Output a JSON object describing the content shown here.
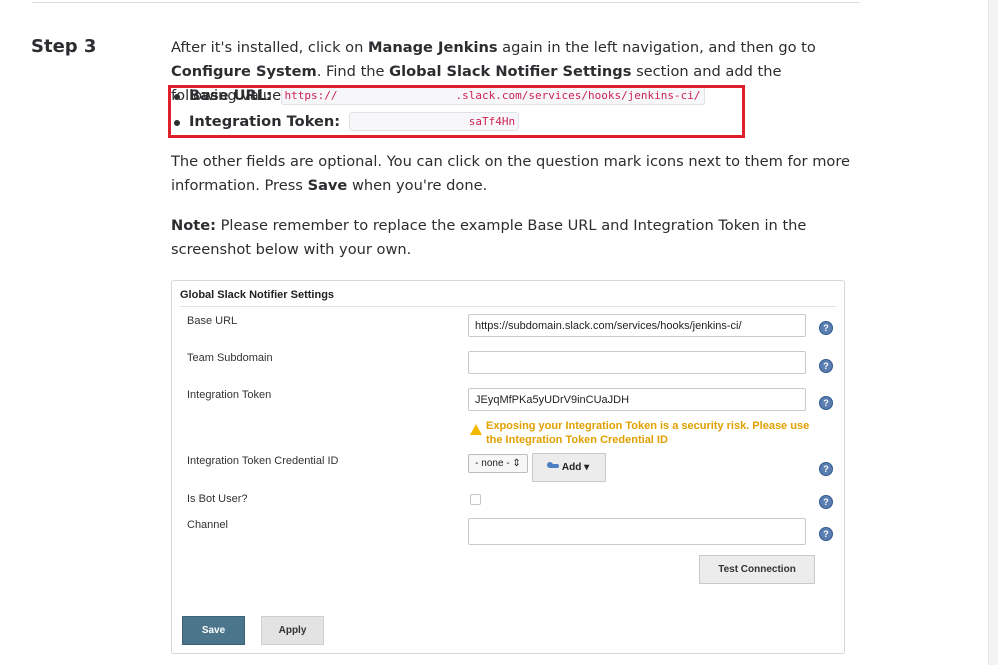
{
  "step": {
    "label": "Step 3"
  },
  "instructions": {
    "p1_a": "After it's installed, click on ",
    "p1_b": "Manage Jenkins",
    "p1_c": " again in the left navigation, and then go to ",
    "p1_d": "Configure System",
    "p1_e": ". Find the ",
    "p1_f": "Global Slack Notifier Settings",
    "p1_g": " section and add the following values:",
    "bullets": [
      {
        "label": "Base URL:",
        "code_start": "https://",
        "code_end": ".slack.com/services/hooks/jenkins-ci/"
      },
      {
        "label": "Integration Token:",
        "code_end": "saTf4Hn"
      }
    ],
    "p2_a": "The other fields are optional. You can click on the question mark icons next to them for more information. Press ",
    "p2_b": "Save",
    "p2_c": " when you're done.",
    "note_label": "Note:",
    "note_text": " Please remember to replace the example Base URL and Integration Token in the screenshot below with your own."
  },
  "panel": {
    "title": "Global Slack Notifier Settings",
    "fields": [
      {
        "label": "Base URL",
        "value": "https://subdomain.slack.com/services/hooks/jenkins-ci/"
      },
      {
        "label": "Team Subdomain",
        "value": ""
      },
      {
        "label": "Integration Token",
        "value": "JEyqMfPKa5yUDrV9inCUaJDH"
      },
      {
        "label": "Integration Token Credential ID"
      },
      {
        "label": "Is Bot User?"
      },
      {
        "label": "Channel",
        "value": ""
      }
    ],
    "warning": "Exposing your Integration Token is a security risk. Please use the Integration Token Credential ID",
    "credential_select": "- none -",
    "add_button": "Add",
    "help_glyph": "?",
    "test_button": "Test Connection",
    "save_button": "Save",
    "apply_button": "Apply"
  },
  "colors": {
    "highlight": "#e01f2e",
    "save_bg": "#4b758b",
    "warning": "#e0a000",
    "help": "#5a7eb0"
  },
  "icons": [
    "help-icon",
    "warning-icon",
    "key-icon",
    "select-arrows-icon",
    "caret-down-icon"
  ]
}
